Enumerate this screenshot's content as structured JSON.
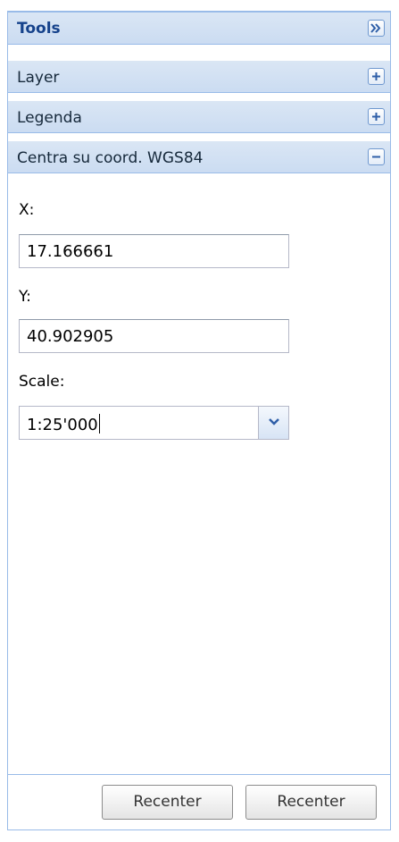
{
  "panel": {
    "title": "Tools",
    "collapse_icon": "double-chevron-right-icon"
  },
  "sections": [
    {
      "label": "Layer",
      "icon": "plus-icon",
      "expanded": false
    },
    {
      "label": "Legenda",
      "icon": "plus-icon",
      "expanded": false
    },
    {
      "label": "Centra su coord. WGS84",
      "icon": "minus-icon",
      "expanded": true
    }
  ],
  "form": {
    "x_label": "X:",
    "x_value": "17.166661",
    "y_label": "Y:",
    "y_value": "40.902905",
    "scale_label": "Scale:",
    "scale_value": "1:25'000"
  },
  "footer": {
    "button1_label": "Recenter",
    "button2_label": "Recenter"
  },
  "colors": {
    "header_bg": "#cbdcf2",
    "border": "#99bbe8",
    "title_text": "#15428b"
  }
}
